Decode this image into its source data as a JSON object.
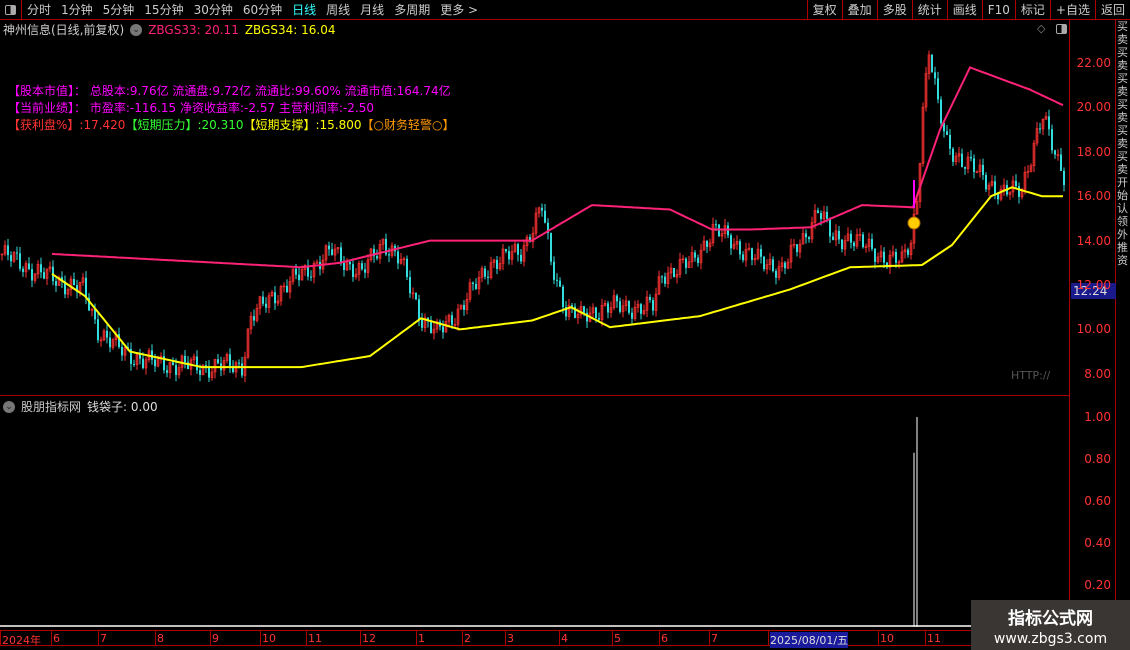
{
  "toolbar": {
    "periods": [
      "分时",
      "1分钟",
      "5分钟",
      "15分钟",
      "30分钟",
      "60分钟",
      "日线",
      "周线",
      "月线",
      "多周期",
      "更多 >"
    ],
    "active": "日线",
    "actions": [
      "复权",
      "叠加",
      "多股",
      "统计",
      "画线",
      "F10",
      "标记",
      "+自选",
      "返回"
    ]
  },
  "title": {
    "stock": "神州信息(日线,前复权)",
    "zb33": "ZBGS33: 20.11",
    "zb34": "ZBGS34: 16.04"
  },
  "info": {
    "line1": "【股本市值】： 总股本:9.76亿 流通盘:9.72亿 流通比:99.60% 流通市值:164.74亿",
    "line2": "【当前业绩】： 市盈率:-116.15 净资收益率:-2.57 主营利润率:-2.50",
    "l3a": "【获利盘%】:17.420",
    "l3b": "【短期压力】:20.310",
    "l3c": "【短期支撑】:15.800",
    "l3d": "【○财务轻警○】"
  },
  "colors": {
    "up": "#ff3333",
    "down": "#33dddd",
    "zbgs33": "#ff2277",
    "zbgs34": "#ffff00",
    "accent": "#aa0000"
  },
  "price_axis": {
    "ticks": [
      "22.00",
      "20.00",
      "18.00",
      "16.00",
      "14.00",
      "12.00",
      "10.00",
      "8.00"
    ],
    "current": "12.24"
  },
  "watermark_http": "HTTP://",
  "indicator": {
    "title": "股朋指标网",
    "value": "钱袋子: 0.00",
    "ticks": [
      "1.00",
      "0.80",
      "0.60",
      "0.40",
      "0.20"
    ]
  },
  "xaxis": {
    "labels": [
      "2024年",
      "6",
      "7",
      "8",
      "9",
      "10",
      "11",
      "12",
      "1",
      "2",
      "3",
      "4",
      "5",
      "6",
      "7",
      "2025/08/01/五",
      "10",
      "11"
    ]
  },
  "right_strip": "买卖买卖买卖买卖买卖买卖开始认领外推资",
  "watermark": {
    "line1": "指标公式网",
    "line2": "www.zbgs3.com"
  },
  "chart_data": {
    "type": "candlestick",
    "price_path": [
      [
        0,
        13.4
      ],
      [
        13,
        12.5
      ],
      [
        27,
        11.8
      ],
      [
        32,
        10
      ],
      [
        40,
        9
      ],
      [
        50,
        8.5
      ],
      [
        67,
        8.3
      ],
      [
        80,
        8.4
      ],
      [
        83,
        10.5
      ],
      [
        90,
        11.5
      ],
      [
        100,
        12.5
      ],
      [
        110,
        13.5
      ],
      [
        120,
        12.5
      ],
      [
        127,
        14
      ],
      [
        133,
        13
      ],
      [
        140,
        10.5
      ],
      [
        145,
        9.8
      ],
      [
        153,
        11
      ],
      [
        163,
        13
      ],
      [
        173,
        13.5
      ],
      [
        180,
        15.5
      ],
      [
        183,
        13
      ],
      [
        188,
        11
      ],
      [
        193,
        10.5
      ],
      [
        200,
        11
      ],
      [
        210,
        11
      ],
      [
        217,
        11
      ],
      [
        220,
        12.5
      ],
      [
        230,
        13
      ],
      [
        237,
        14.5
      ],
      [
        243,
        14
      ],
      [
        253,
        13
      ],
      [
        260,
        12.8
      ],
      [
        267,
        14
      ],
      [
        272,
        15.5
      ],
      [
        277,
        14
      ],
      [
        283,
        14.2
      ],
      [
        290,
        13.5
      ],
      [
        300,
        13
      ],
      [
        303,
        14
      ],
      [
        305,
        16
      ],
      [
        307,
        20
      ],
      [
        309,
        22.5
      ],
      [
        312,
        20
      ],
      [
        315,
        18.5
      ],
      [
        320,
        17.5
      ],
      [
        327,
        17
      ],
      [
        333,
        16
      ],
      [
        340,
        16.5
      ],
      [
        347,
        19.5
      ],
      [
        354,
        17
      ]
    ],
    "zbgs33": [
      [
        17,
        13.4
      ],
      [
        100,
        12.8
      ],
      [
        113,
        13
      ],
      [
        143,
        14
      ],
      [
        177,
        14
      ],
      [
        197,
        15.6
      ],
      [
        223,
        15.4
      ],
      [
        237,
        14.5
      ],
      [
        250,
        14.5
      ],
      [
        270,
        14.6
      ],
      [
        287,
        15.6
      ],
      [
        304,
        15.5
      ],
      [
        313,
        19
      ],
      [
        323,
        21.8
      ],
      [
        343,
        20.8
      ],
      [
        354,
        20.1
      ]
    ],
    "zbgs34": [
      [
        17,
        12.5
      ],
      [
        28,
        11.5
      ],
      [
        43,
        9
      ],
      [
        67,
        8.3
      ],
      [
        100,
        8.3
      ],
      [
        123,
        8.8
      ],
      [
        140,
        10.5
      ],
      [
        153,
        10
      ],
      [
        177,
        10.4
      ],
      [
        190,
        11
      ],
      [
        203,
        10.1
      ],
      [
        233,
        10.6
      ],
      [
        263,
        11.8
      ],
      [
        283,
        12.8
      ],
      [
        307,
        12.9
      ],
      [
        317,
        13.8
      ],
      [
        330,
        16
      ],
      [
        337,
        16.4
      ],
      [
        347,
        16
      ],
      [
        354,
        16
      ]
    ],
    "indicator_spikes": [
      [
        304,
        0.83
      ],
      [
        305,
        1.0
      ]
    ],
    "ylim": [
      7.2,
      23.5
    ],
    "indicator_ylim": [
      0,
      1.05
    ]
  }
}
